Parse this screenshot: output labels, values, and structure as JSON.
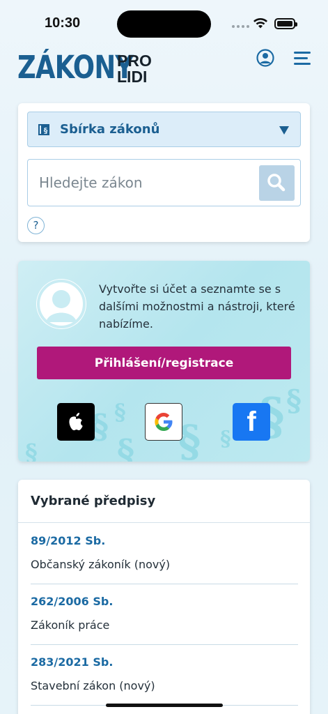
{
  "status": {
    "time": "10:30"
  },
  "header": {
    "logo_main": "ZÁKONY",
    "logo_pro": "PRO",
    "logo_lidi": "LIDI",
    "icons": [
      "account-icon",
      "menu-icon"
    ]
  },
  "search": {
    "collection_label": "Sbírka zákonů",
    "placeholder": "Hledejte zákon",
    "help": "?"
  },
  "register": {
    "text": "Vytvořte si účet a seznamte se s dalšími možnostmi a nástroji, které nabízíme.",
    "button_label": "Přihlášení/registrace",
    "providers": [
      "apple-icon",
      "google-icon",
      "facebook-icon"
    ],
    "facebook_glyph": "f"
  },
  "selected": {
    "title": "Vybrané předpisy",
    "items": [
      {
        "code": "89/2012 Sb.",
        "name": "Občanský zákoník (nový)"
      },
      {
        "code": "262/2006 Sb.",
        "name": "Zákoník práce"
      },
      {
        "code": "283/2021 Sb.",
        "name": "Stavební zákon (nový)"
      }
    ]
  },
  "colors": {
    "brand_blue": "#1b5f91",
    "accent_magenta": "#b0187a",
    "link_blue": "#1b6aa3"
  }
}
